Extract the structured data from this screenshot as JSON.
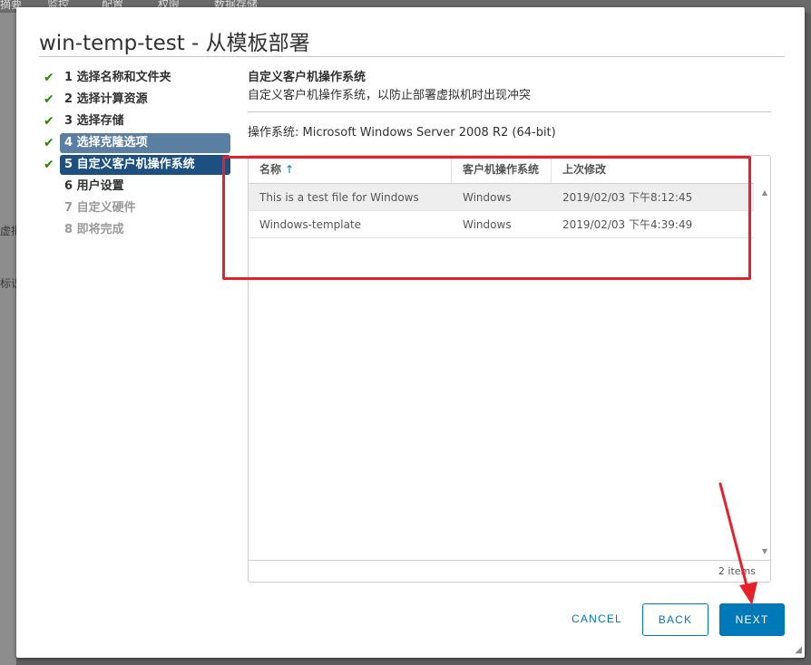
{
  "background_app": {
    "tabs": [
      "摘要",
      "监控",
      "配置",
      "权限",
      "数据存储"
    ],
    "fragments": [
      "虚拟",
      "标识"
    ]
  },
  "dialog": {
    "title": "win-temp-test - 从模板部署"
  },
  "wizard": {
    "steps": [
      {
        "num": "1",
        "label": "选择名称和文件夹",
        "state": "complete"
      },
      {
        "num": "2",
        "label": "选择计算资源",
        "state": "complete"
      },
      {
        "num": "3",
        "label": "选择存储",
        "state": "complete"
      },
      {
        "num": "4",
        "label": "选择克隆选项",
        "state": "visited"
      },
      {
        "num": "5",
        "label": "自定义客户机操作系统",
        "state": "current"
      },
      {
        "num": "6",
        "label": "用户设置",
        "state": "enabled"
      },
      {
        "num": "7",
        "label": "自定义硬件",
        "state": "disabled"
      },
      {
        "num": "8",
        "label": "即将完成",
        "state": "disabled"
      }
    ],
    "check_glyph": "✔"
  },
  "content": {
    "section_title": "自定义客户机操作系统",
    "section_desc": "自定义客户机操作系统，以防止部署虚拟机时出现冲突",
    "os_label": "操作系统: Microsoft Windows Server 2008 R2 (64-bit)"
  },
  "grid": {
    "columns": [
      "名称",
      "客户机操作系统",
      "上次修改"
    ],
    "sort_icon": "↑",
    "rows": [
      {
        "name": "This is a test file for Windows",
        "os": "Windows",
        "modified": "2019/02/03 下午8:12:45",
        "selected": true
      },
      {
        "name": "Windows-template",
        "os": "Windows",
        "modified": "2019/02/03 下午4:39:49",
        "selected": false
      }
    ],
    "footer": "2 items"
  },
  "buttons": {
    "cancel": "CANCEL",
    "back": "BACK",
    "next": "NEXT"
  },
  "colors": {
    "primary": "#0079b8",
    "current_step": "#1d4f80",
    "visited_step": "#5b7fa3",
    "check": "#2f8400",
    "annotation": "#e8202a"
  }
}
